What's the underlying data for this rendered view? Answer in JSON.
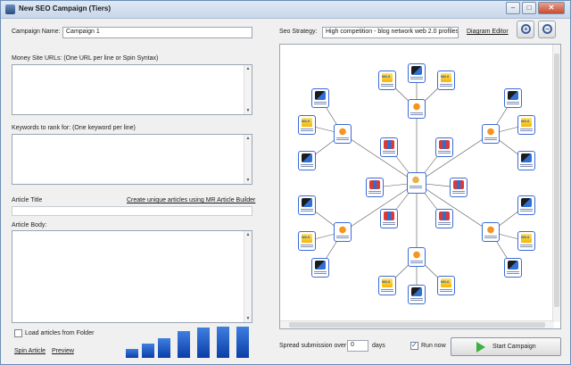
{
  "window": {
    "title": "New SEO Campaign (Tiers)"
  },
  "left": {
    "campaign_name_label": "Campaign Name:",
    "campaign_name_value": "Campaign 1",
    "money_urls_label": "Money Site URLs: (One URL per line or Spin Syntax)",
    "keywords_label": "Keywords to rank for: (One keyword per line)",
    "article_title_label": "Article Title",
    "create_articles_link": "Create unique articles using MR Article Builder",
    "article_body_label": "Article Body:",
    "load_articles_label": "Load articles from Folder",
    "spin_article_link": "Spin Article",
    "preview_link": "Preview"
  },
  "right": {
    "seo_strategy_label": "Seo Strategy:",
    "seo_strategy_value": "High competition - blog network web 2.0 profiles",
    "diagram_editor_link": "Diagram Editor",
    "spread_label": "Spread submission over",
    "spread_value": "0",
    "days_label": "days",
    "run_now_label": "Run now",
    "start_campaign_label": "Start Campaign"
  },
  "icons": {
    "zoom_in": "zoom-in-icon",
    "zoom_out": "zoom-out-icon",
    "start": "play-icon"
  },
  "colors": {
    "node_border": "#3b6bd6",
    "start_green": "#3cb043",
    "bar_blue": "#1e5ccc"
  }
}
